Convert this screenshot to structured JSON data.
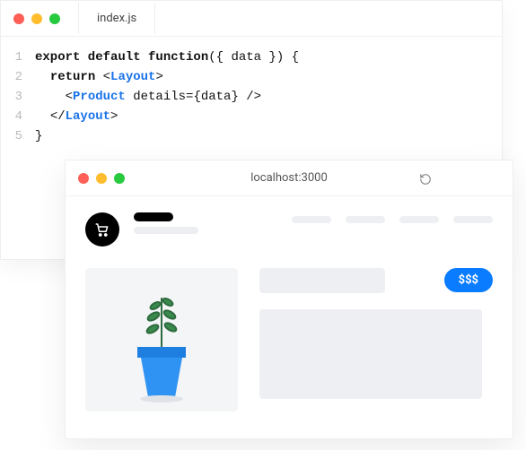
{
  "editor": {
    "tab": "index.js",
    "lines": [
      {
        "n": "1",
        "indent": "",
        "tokens": [
          {
            "t": "export default function",
            "c": "kw"
          },
          {
            "t": "({ data }) {",
            "c": "plain"
          }
        ]
      },
      {
        "n": "2",
        "indent": "  ",
        "tokens": [
          {
            "t": "return",
            "c": "kw"
          },
          {
            "t": " ",
            "c": "plain"
          },
          {
            "t": "<",
            "c": "angle"
          },
          {
            "t": "Layout",
            "c": "tagc"
          },
          {
            "t": ">",
            "c": "angle"
          }
        ]
      },
      {
        "n": "3",
        "indent": "    ",
        "tokens": [
          {
            "t": "<",
            "c": "angle"
          },
          {
            "t": "Product",
            "c": "tagc"
          },
          {
            "t": " details={data} ",
            "c": "attr"
          },
          {
            "t": "/>",
            "c": "angle"
          }
        ]
      },
      {
        "n": "4",
        "indent": "  ",
        "tokens": [
          {
            "t": "</",
            "c": "angle"
          },
          {
            "t": "Layout",
            "c": "tagc"
          },
          {
            "t": ">",
            "c": "angle"
          }
        ]
      },
      {
        "n": "5",
        "indent": "",
        "tokens": [
          {
            "t": "}",
            "c": "plain"
          }
        ]
      }
    ]
  },
  "browser": {
    "address": "localhost:3000",
    "price_label": "$$$"
  }
}
